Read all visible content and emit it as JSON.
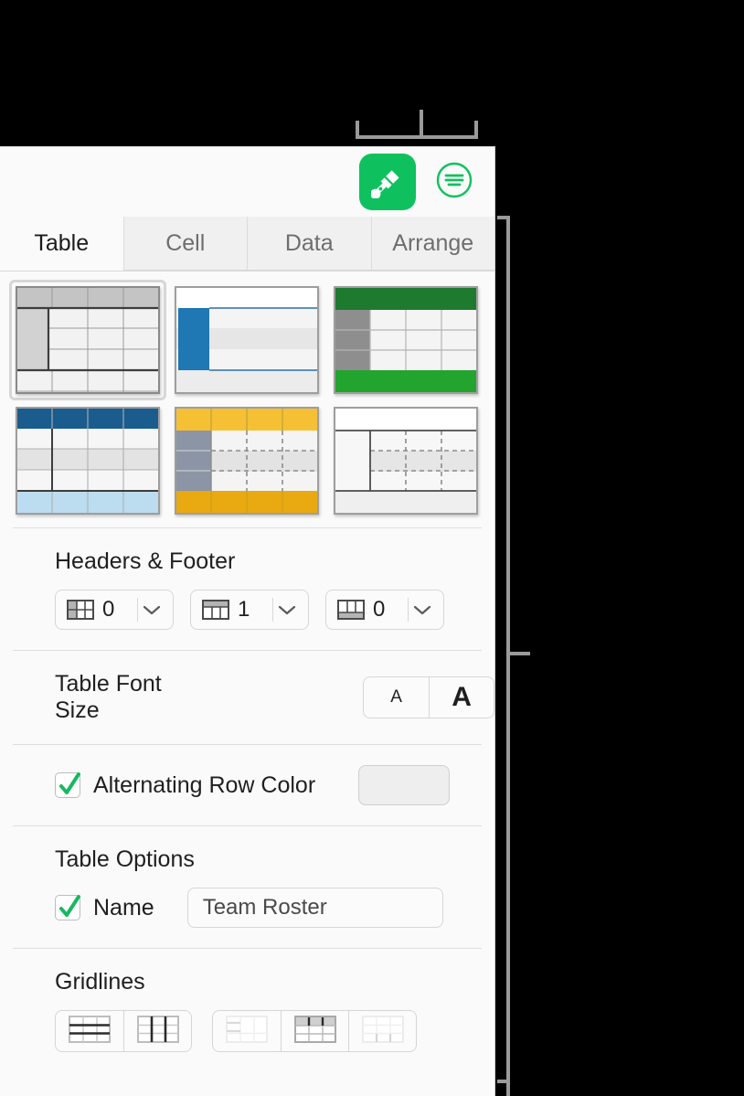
{
  "panel": {
    "toolbar": {
      "format_button_label": "Format",
      "format_icon": "paintbrush-icon",
      "menu_button_label": "Document Options",
      "menu_icon": "list-circle-icon",
      "accent_color": "#0ec15e"
    },
    "tabs": [
      {
        "label": "Table",
        "active": true
      },
      {
        "label": "Cell",
        "active": false
      },
      {
        "label": "Data",
        "active": false
      },
      {
        "label": "Arrange",
        "active": false
      }
    ],
    "table_styles": [
      {
        "name": "gray-header-style",
        "selected": true
      },
      {
        "name": "blue-sidebar-style",
        "selected": false
      },
      {
        "name": "green-header-footer-style",
        "selected": false
      },
      {
        "name": "blue-header-footer-style",
        "selected": false
      },
      {
        "name": "yellow-header-footer-style",
        "selected": false
      },
      {
        "name": "plain-dashed-style",
        "selected": false
      }
    ],
    "headers_footer": {
      "title": "Headers & Footer",
      "controls": [
        {
          "icon": "header-columns-icon",
          "value": "0",
          "name": "header-columns-stepper"
        },
        {
          "icon": "header-rows-icon",
          "value": "1",
          "name": "header-rows-stepper"
        },
        {
          "icon": "footer-rows-icon",
          "value": "0",
          "name": "footer-rows-stepper"
        }
      ]
    },
    "font_size": {
      "label": "Table Font Size",
      "decrease_label": "A",
      "increase_label": "A"
    },
    "alternating_row_color": {
      "label": "Alternating Row Color",
      "checked": true,
      "swatch_color": "#eeeeee"
    },
    "table_options": {
      "title": "Table Options",
      "name_label": "Name",
      "name_checked": true,
      "name_value": "Team Roster",
      "name_placeholder": "Name"
    },
    "gridlines": {
      "title": "Gridlines",
      "primary_buttons": [
        {
          "name": "horizontal-gridlines-button",
          "icon": "horizontal-gridlines-icon",
          "enabled": true
        },
        {
          "name": "vertical-gridlines-button",
          "icon": "vertical-gridlines-icon",
          "enabled": true
        }
      ],
      "secondary_buttons": [
        {
          "name": "header-row-gridlines-button",
          "icon": "header-row-gridlines-icon",
          "enabled": false
        },
        {
          "name": "header-column-gridlines-button",
          "icon": "header-column-gridlines-icon",
          "enabled": true
        },
        {
          "name": "footer-row-gridlines-button",
          "icon": "footer-row-gridlines-icon",
          "enabled": false
        }
      ]
    }
  },
  "annotations": {
    "toolbar_callout": "bracket pointing to format and menu buttons",
    "panel_callout": "bracket spanning format panel"
  }
}
